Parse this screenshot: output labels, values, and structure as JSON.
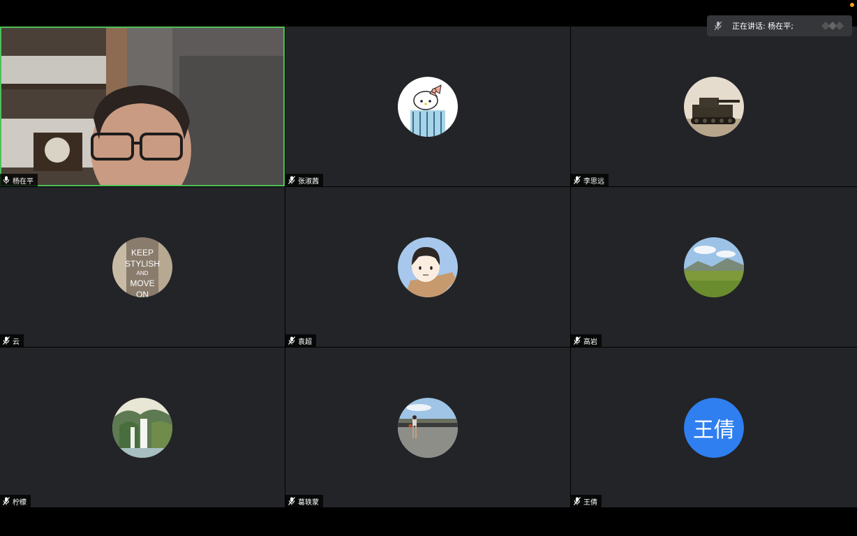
{
  "speaking_banner": {
    "label": "正在讲话: 杨在平;"
  },
  "participants": [
    {
      "name": "杨在平",
      "avatar": "video",
      "muted": false
    },
    {
      "name": "张淑茜",
      "avatar": "hello-kitty-image",
      "muted": true
    },
    {
      "name": "李思远",
      "avatar": "tank-image",
      "muted": true
    },
    {
      "name": "云",
      "avatar": "keep-stylish-image",
      "muted": true,
      "avatar_text": [
        "KEEP",
        "STYLISH",
        "AND",
        "MOVE",
        "ON"
      ]
    },
    {
      "name": "袁超",
      "avatar": "cartoon-boy-image",
      "muted": true
    },
    {
      "name": "高岩",
      "avatar": "landscape-image",
      "muted": true
    },
    {
      "name": "柠檬",
      "avatar": "waterfall-image",
      "muted": true
    },
    {
      "name": "葛轶蒙",
      "avatar": "person-road-image",
      "muted": true
    },
    {
      "name": "王倩",
      "avatar": "initials",
      "muted": true,
      "initials": "王倩",
      "avatar_color": "#2f7ff0"
    }
  ],
  "colors": {
    "active_border": "#4cc158",
    "tile_bg": "#232427"
  }
}
